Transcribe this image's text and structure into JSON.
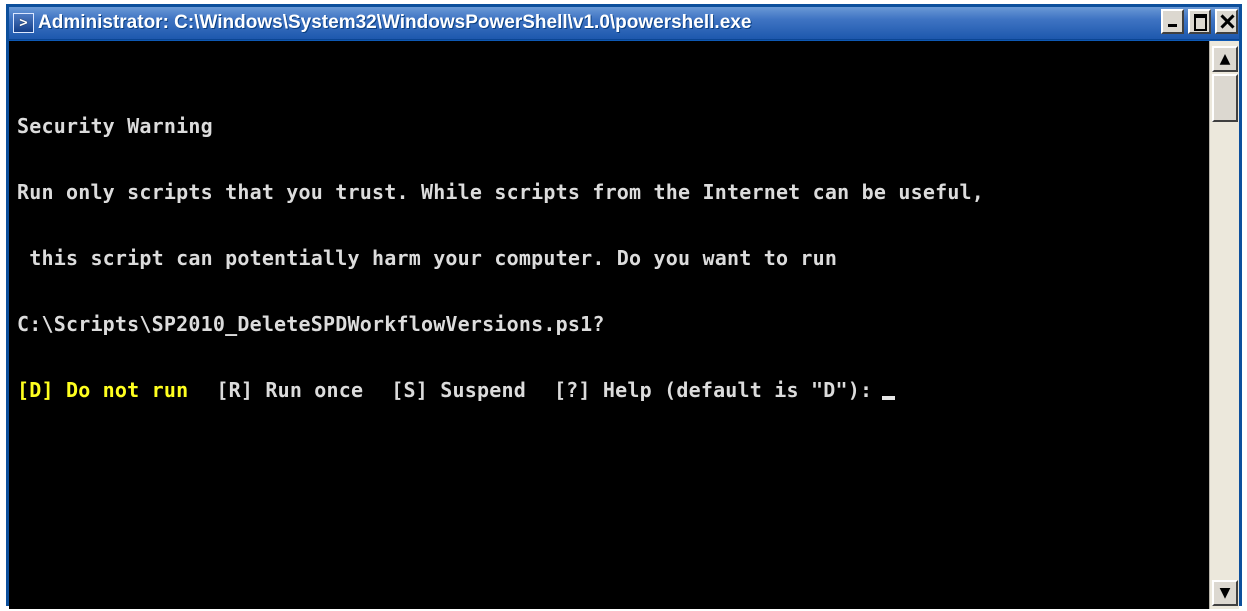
{
  "window": {
    "title": "Administrator: C:\\Windows\\System32\\WindowsPowerShell\\v1.0\\powershell.exe",
    "icon": "powershell-icon",
    "controls": [
      "minimize-icon",
      "maximize-icon",
      "close-icon"
    ]
  },
  "console": {
    "lines": [
      "Security Warning",
      "Run only scripts that you trust. While scripts from the Internet can be useful,",
      " this script can potentially harm your computer. Do you want to run",
      "C:\\Scripts\\SP2010_DeleteSPDWorkflowVersions.ps1?"
    ],
    "prompt": {
      "option_default": "[D] Do not run",
      "option_run_once": "[R] Run once",
      "option_suspend": "[S] Suspend",
      "option_help": "[?] Help (default is \"D\"):"
    }
  },
  "scrollbar": {
    "up_icon": "chevron-up-icon",
    "down_icon": "chevron-down-icon"
  },
  "colors": {
    "console_background": "#000000",
    "console_text": "#dcdcdc",
    "highlight_text": "#ffff1f",
    "titlebar": "#1d58ad"
  }
}
